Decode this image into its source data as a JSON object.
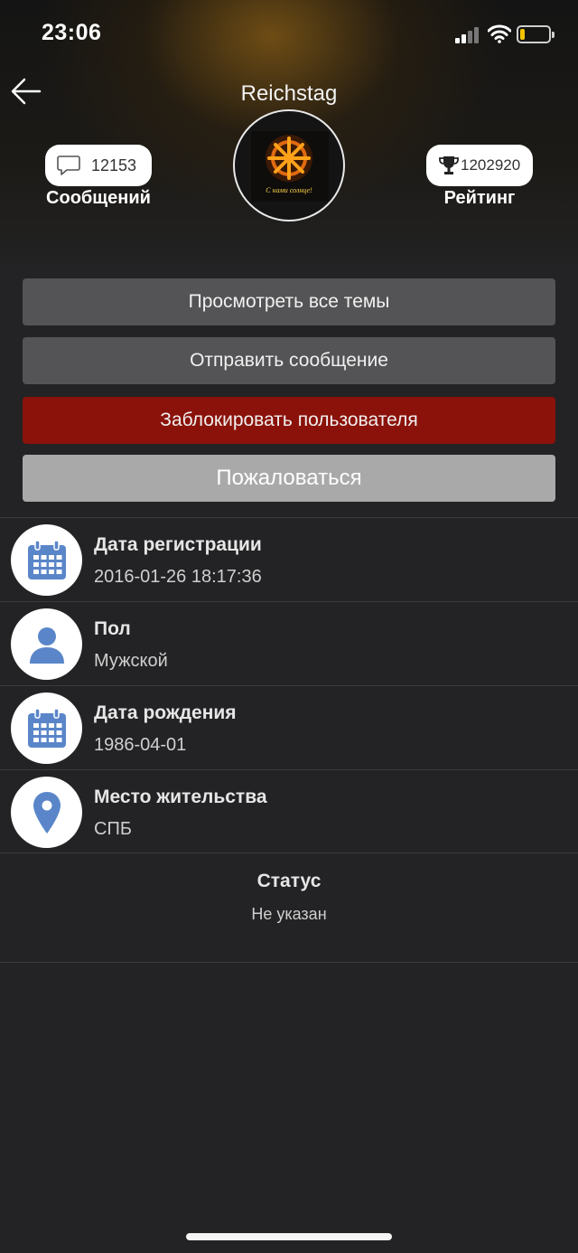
{
  "status_bar": {
    "time": "23:06"
  },
  "profile": {
    "username": "Reichstag",
    "avatar_caption": "С нами солнце!",
    "messages_count": "12153",
    "messages_label": "Сообщений",
    "rating_value": "1202920",
    "rating_label": "Рейтинг"
  },
  "actions": {
    "view_topics": "Просмотреть все темы",
    "send_message": "Отправить сообщение",
    "block_user": "Заблокировать пользователя",
    "report": "Пожаловаться"
  },
  "info": [
    {
      "title": "Дата регистрации",
      "value": "2016-01-26 18:17:36",
      "icon": "calendar-icon"
    },
    {
      "title": "Пол",
      "value": "Мужской",
      "icon": "user-icon"
    },
    {
      "title": "Дата рождения",
      "value": "1986-04-01",
      "icon": "calendar-icon"
    },
    {
      "title": "Место жительства",
      "value": "СПБ",
      "icon": "location-pin-icon"
    }
  ],
  "status": {
    "title": "Статус",
    "value": "Не указан"
  },
  "colors": {
    "background": "#232325",
    "button_gray": "#545456",
    "button_block": "#8b120a",
    "button_report": "#a9a9a9",
    "icon_blue": "#5a86c9"
  }
}
